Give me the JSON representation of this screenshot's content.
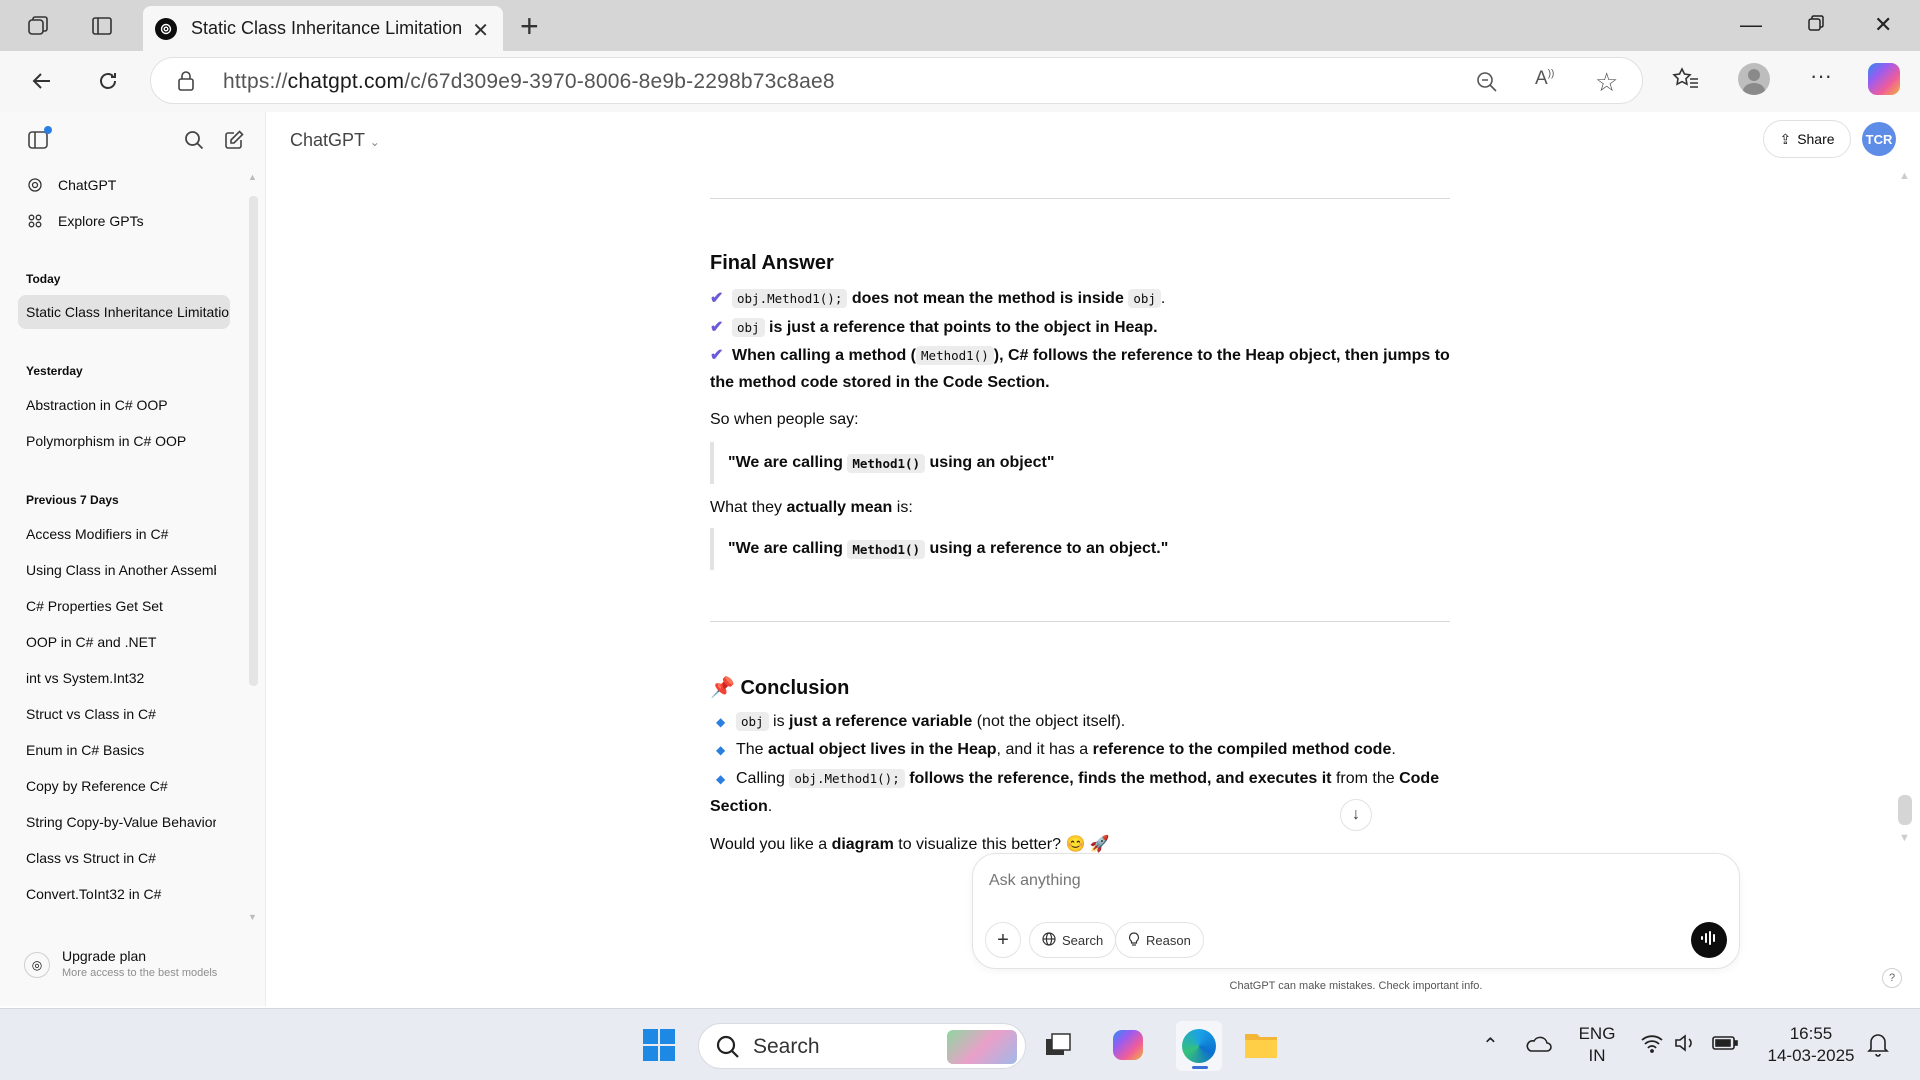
{
  "browser": {
    "tab_title": "Static Class Inheritance Limitation",
    "url_prefix": "https://",
    "url_domain": "chatgpt.com",
    "url_path": "/c/67d309e9-3970-8006-8e9b-2298b73c8ae8"
  },
  "sidebar": {
    "links": [
      {
        "label": "ChatGPT",
        "icon": "openai-icon"
      },
      {
        "label": "Explore GPTs",
        "icon": "grid-icon"
      }
    ],
    "groups": [
      {
        "label": "Today",
        "items": [
          "Static Class Inheritance Limitation"
        ]
      },
      {
        "label": "Yesterday",
        "items": [
          "Abstraction in C# OOP",
          "Polymorphism in C# OOP"
        ]
      },
      {
        "label": "Previous 7 Days",
        "items": [
          "Access Modifiers in C#",
          "Using Class in Another Assembly",
          "C# Properties Get Set",
          "OOP in C# and .NET",
          "int vs System.Int32",
          "Struct vs Class in C#",
          "Enum in C# Basics",
          "Copy by Reference C#",
          "String Copy-by-Value Behavior",
          "Class vs Struct in C#",
          "Convert.ToInt32 in C#"
        ]
      }
    ],
    "upgrade": {
      "title": "Upgrade plan",
      "subtitle": "More access to the best models"
    }
  },
  "header": {
    "model": "ChatGPT",
    "share_label": "Share",
    "avatar_initials": "TCR"
  },
  "message": {
    "final_heading": "Final Answer",
    "final_b1_code": "obj.Method1();",
    "final_b1_text": "does not mean the method is inside",
    "final_b1_code2": "obj",
    "final_b1_end": ".",
    "final_b2_code": "obj",
    "final_b2_text": "is just a reference that points to the object in Heap.",
    "final_b3_pre": "When calling a method (",
    "final_b3_code": "Method1()",
    "final_b3_post": "), C# follows the reference to the Heap object, then jumps to",
    "final_b3_cont": "the method code stored in the Code Section.",
    "people_say": "So when people say:",
    "quote1_pre": "\"We are calling",
    "quote1_code": "Method1()",
    "quote1_post": "using an object\"",
    "they_mean_pre": "What they",
    "they_mean_bold": "actually mean",
    "they_mean_post": "is:",
    "quote2_pre": "\"We are calling",
    "quote2_code": "Method1()",
    "quote2_post": "using a reference to an object.\"",
    "conclusion_heading": "Conclusion",
    "c1_code": "obj",
    "c1_is": "is",
    "c1_bold": "just a reference variable",
    "c1_rest": "(not the object itself).",
    "c2_the": "The",
    "c2_bold1": "actual object lives in the Heap",
    "c2_mid": ", and it has a",
    "c2_bold2": "reference to the compiled method code",
    "c2_end": ".",
    "c3_pre": "Calling",
    "c3_code": "obj.Method1();",
    "c3_bold": "follows the reference, finds the method, and executes it",
    "c3_from": "from the",
    "c3_bold2": "Code",
    "c3_cont": "Section",
    "c3_end": ".",
    "follow_pre": "Would you like a",
    "follow_bold": "diagram",
    "follow_post": "to visualize this better? 😊 🚀"
  },
  "composer": {
    "placeholder": "Ask anything",
    "search_label": "Search",
    "reason_label": "Reason",
    "disclaimer": "ChatGPT can make mistakes. Check important info."
  },
  "taskbar": {
    "search_label": "Search",
    "lang_top": "ENG",
    "lang_bottom": "IN",
    "time": "16:55",
    "date": "14-03-2025"
  }
}
